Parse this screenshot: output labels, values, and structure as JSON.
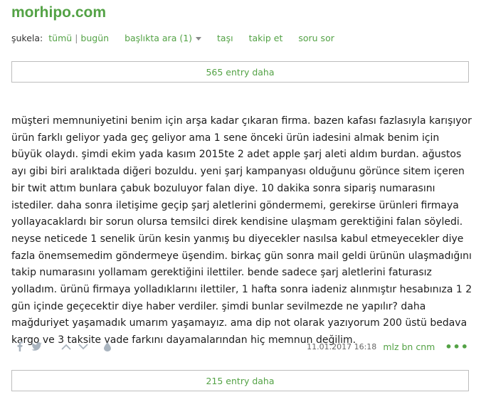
{
  "topic": {
    "title": "morhipo.com"
  },
  "subnav": {
    "sukela_label": "şukela:",
    "all_label": "tümü",
    "separator": "|",
    "today_label": "bugün",
    "search_in_title_label": "başlıkta ara (1)",
    "move_label": "taşı",
    "follow_label": "takip et",
    "ask_label": "soru sor"
  },
  "more_before": {
    "label": "565 entry daha"
  },
  "entry": {
    "text": "müşteri memnuniyetini benim için arşa kadar çıkaran firma. bazen kafası fazlasıyla karışıyor ürün farklı geliyor yada geç geliyor ama 1 sene önceki ürün iadesini almak benim için büyük olaydı. şimdi ekim yada kasım 2015te 2 adet apple şarj aleti aldım burdan. ağustos ayı gibi biri aralıktada diğeri bozuldu. yeni şarj kampanyası olduğunu görünce sitem içeren bir twit attım bunlara çabuk bozuluyor falan diye. 10 dakika sonra sipariş numarasını istediler. daha sonra iletişime geçip şarj aletlerini göndermemi, gerekirse ürünleri firmaya yollayacaklardı bir sorun olursa temsilci direk kendisine ulaşmam gerektiğini falan söyledi. neyse neticede 1 senelik ürün kesin yanmış bu diyecekler nasılsa kabul etmeyecekler diye fazla önemsemedim göndermeye üşendim. birkaç gün sonra mail geldi ürünün ulaşmadığını takip numarasını yollamam gerektiğini ilettiler. bende sadece şarj aletlerini faturasız yolladım. ürünü firmaya yolladıklarını ilettiler, 1 hafta sonra iadeniz alınmıştır hesabınıza 1 2 gün içinde geçecektir diye haber verdiler. şimdi bunlar sevilmezde ne yapılır? daha mağduriyet yaşamadık umarım yaşamayız. ama dip not olarak yazıyorum 200 üstü bedava kargo ve 3 taksite vade farkını dayamalarından hiç memnun değilim.",
    "date": "11.01.2017 16:18",
    "author": "mlz bn cnm",
    "more_options": "•••",
    "icons": {
      "share_facebook": "facebook-icon",
      "share_twitter": "twitter-icon",
      "upvote": "chevron-up-icon",
      "downvote": "chevron-down-icon",
      "favorite": "drop-icon"
    }
  },
  "more_after": {
    "label": "215 entry daha"
  },
  "colors": {
    "brand_green": "#53a245",
    "text": "#1c1c1c",
    "muted_icon": "#a9b4bf",
    "border": "#bdbdbd"
  }
}
